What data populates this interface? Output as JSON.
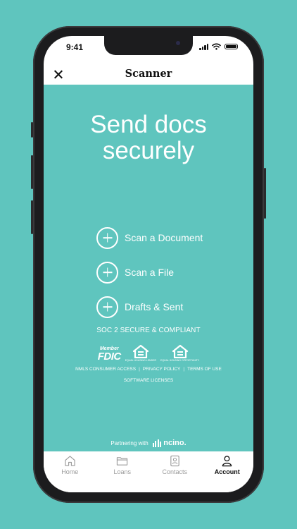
{
  "status_bar": {
    "time": "9:41"
  },
  "header": {
    "title": "Scanner"
  },
  "main": {
    "headline_line1": "Send docs",
    "headline_line2": "securely",
    "actions": [
      {
        "label": "Scan a Document"
      },
      {
        "label": "Scan a File"
      },
      {
        "label": "Drafts & Sent"
      }
    ],
    "compliance": "SOC 2 SECURE & COMPLIANT",
    "fdic_member": "Member",
    "fdic_word": "FDIC",
    "badge_caption_1": "EQUAL HOUSING LENDER",
    "badge_caption_2": "EQUAL HOUSING OPPORTUNITY",
    "links": {
      "nmls": "NMLS CONSUMER ACCESS",
      "privacy": "PRIVACY POLICY",
      "terms": "TERMS OF USE",
      "software": "SOFTWARE LICENSES"
    },
    "partner_text": "Partnering with",
    "partner_brand": "ncino."
  },
  "tabbar": {
    "tabs": [
      {
        "label": "Home",
        "icon": "home-icon"
      },
      {
        "label": "Loans",
        "icon": "folder-icon"
      },
      {
        "label": "Contacts",
        "icon": "contacts-icon"
      },
      {
        "label": "Account",
        "icon": "person-icon",
        "active": true
      }
    ]
  },
  "colors": {
    "teal": "#5fc5be",
    "white": "#ffffff",
    "dark": "#111111"
  }
}
